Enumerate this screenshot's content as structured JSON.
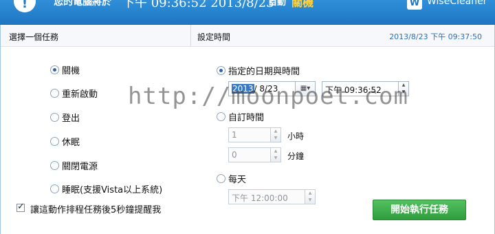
{
  "header": {
    "icon": "info-icon",
    "title": "您的電腦將於",
    "time": "下午 09:36:52 2013/8/23",
    "action_label": "自動",
    "action": "關機",
    "brand_badge": "W",
    "brand": "WiseCleaner"
  },
  "panel": {
    "left_title": "選擇一個任務",
    "right_title": "設定時間",
    "now": "2013/8/23 下午 09:37:50"
  },
  "tasks": [
    {
      "label": "關機",
      "checked": true
    },
    {
      "label": "重新啟動",
      "checked": false
    },
    {
      "label": "登出",
      "checked": false
    },
    {
      "label": "休眠",
      "checked": false
    },
    {
      "label": "關閉電源",
      "checked": false
    },
    {
      "label": "睡眠(支援Vista以上系統)",
      "checked": false
    }
  ],
  "schedule": {
    "specific_label": "指定的日期與時間",
    "date_sel": "2013",
    "date_rest": "/ 8/23",
    "time_value": "下午 09:36:52",
    "countdown_label": "自訂時間",
    "hours_value": "1",
    "hours_unit": "小時",
    "minutes_value": "0",
    "minutes_unit": "分鐘",
    "daily_label": "每天",
    "daily_value": "下午 12:00:00"
  },
  "footer": {
    "checkbox_label": "讓這動作排程任務後5秒鐘提醒我",
    "start_button": "開始執行任務"
  },
  "watermark": "http://moonpoet.com",
  "colors": {
    "header_bg": "#1f76c3",
    "accent": "#ffd23f",
    "start_button": "#2f9d3d"
  }
}
